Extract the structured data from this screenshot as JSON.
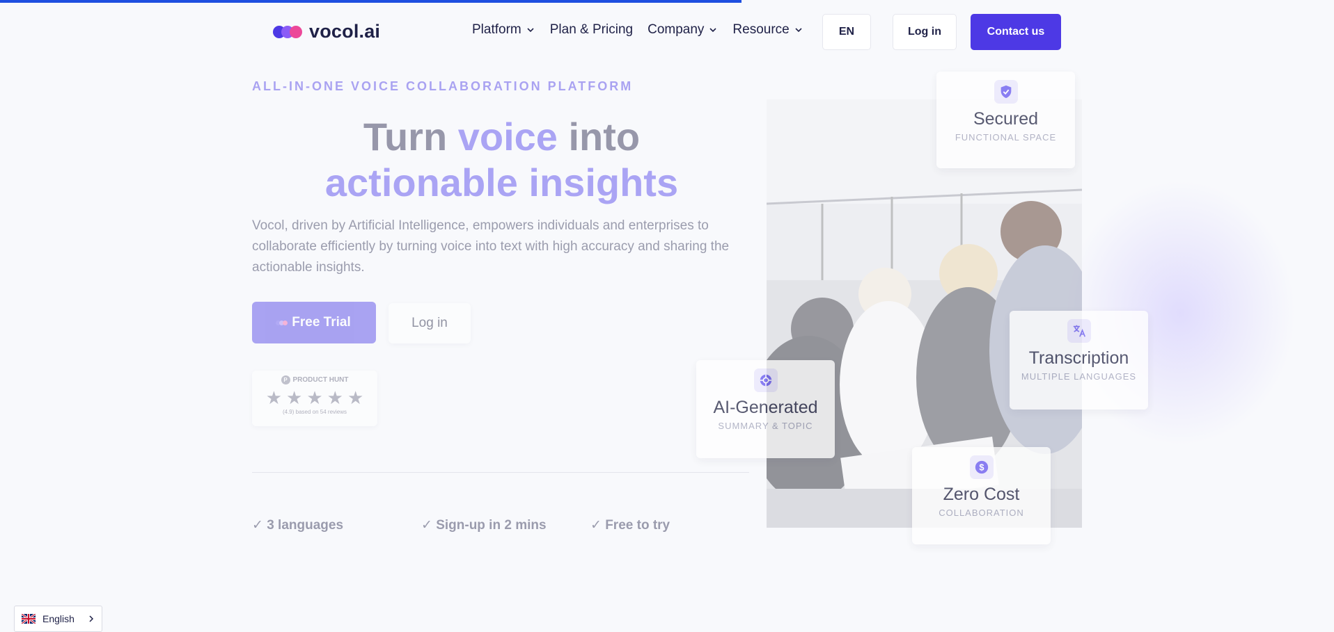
{
  "header": {
    "logo_text": "vocol.ai",
    "logo_colors": [
      "#4d39e5",
      "#8b5cf6",
      "#ec4899"
    ],
    "nav": [
      {
        "label": "Platform",
        "has_dropdown": true
      },
      {
        "label": "Plan & Pricing",
        "has_dropdown": false
      },
      {
        "label": "Company",
        "has_dropdown": true
      },
      {
        "label": "Resource",
        "has_dropdown": true
      }
    ],
    "lang_button": "EN",
    "login_button": "Log in",
    "contact_button": "Contact us",
    "accent_color": "#4d39e5"
  },
  "page_load_progress": 0.556,
  "hero": {
    "eyebrow": "ALL-IN-ONE VOICE COLLABORATION PLATFORM",
    "headline_part1": "Turn ",
    "headline_accent1": "voice",
    "headline_part2": " into",
    "headline_accent2": "actionable insights",
    "description": "Vocol, driven by Artificial Intelligence, empowers individuals and enterprises to collaborate efficiently by turning voice into text with high accuracy and sharing the actionable insights.",
    "free_trial_button": "Free Trial",
    "login_button": "Log in",
    "product_hunt": {
      "label": "PRODUCT HUNT",
      "rating_stars": 5,
      "note": "(4.9) based on 54 reviews"
    },
    "checks": [
      "✓ 3 languages",
      "✓ Sign-up in 2 mins",
      "✓ Free to try"
    ]
  },
  "features": [
    {
      "title": "Secured",
      "subtitle": "FUNCTIONAL SPACE",
      "icon": "shield-check-icon"
    },
    {
      "title": "Transcription",
      "subtitle": "MULTIPLE LANGUAGES",
      "icon": "translate-icon"
    },
    {
      "title": "AI-Generated",
      "subtitle": "SUMMARY & TOPIC",
      "icon": "ai-chip-icon"
    },
    {
      "title": "Zero Cost",
      "subtitle": "COLLABORATION",
      "icon": "dollar-icon"
    }
  ],
  "language_switcher": {
    "label": "English",
    "flag": "uk-flag-icon"
  }
}
